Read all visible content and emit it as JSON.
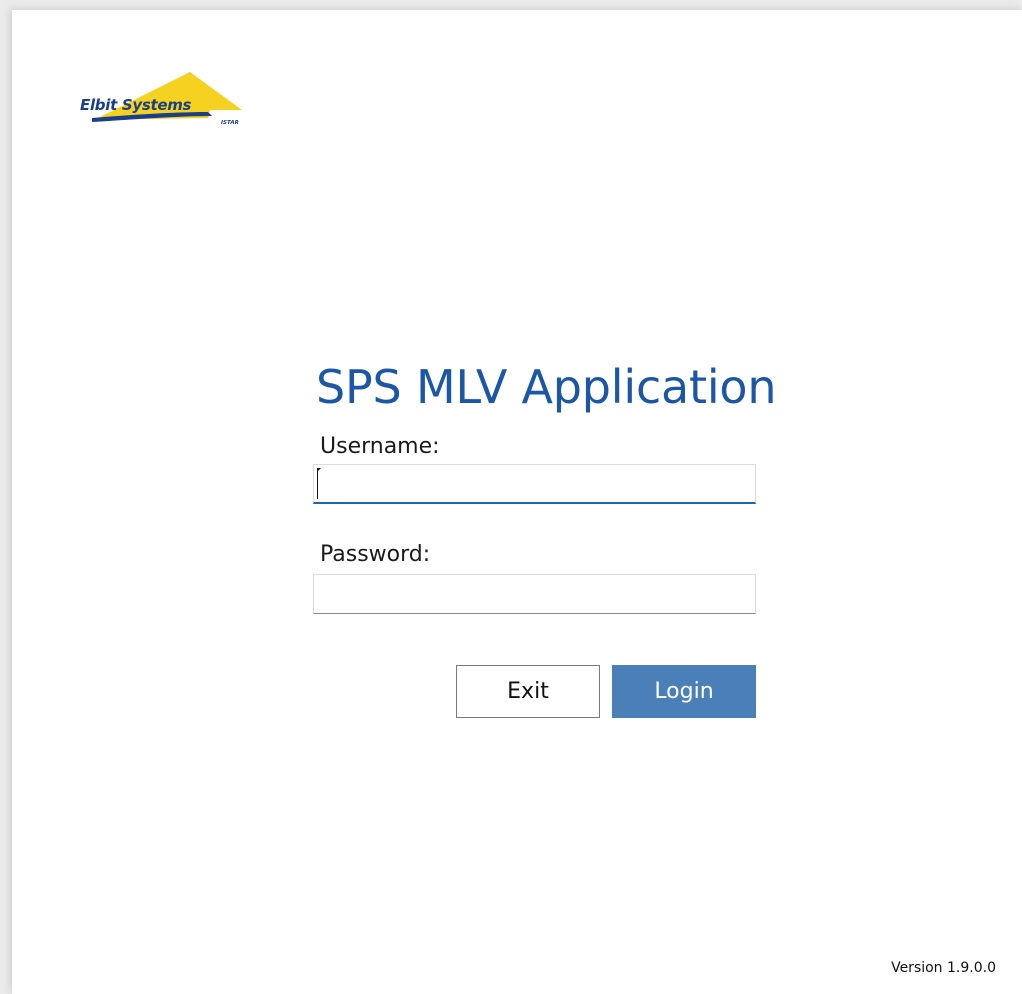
{
  "brand": {
    "name": "Elbit Systems",
    "sub": "ISTAR",
    "colors": {
      "yellow": "#f5d21f",
      "blue": "#1a3f8a"
    }
  },
  "app": {
    "title": "SPS MLV Application"
  },
  "form": {
    "username_label": "Username:",
    "username_value": "",
    "password_label": "Password:",
    "password_value": ""
  },
  "buttons": {
    "exit_label": "Exit",
    "login_label": "Login"
  },
  "footer": {
    "version": "Version 1.9.0.0"
  },
  "colors": {
    "accent": "#1b57a6",
    "login_button": "#4a7fb7"
  }
}
